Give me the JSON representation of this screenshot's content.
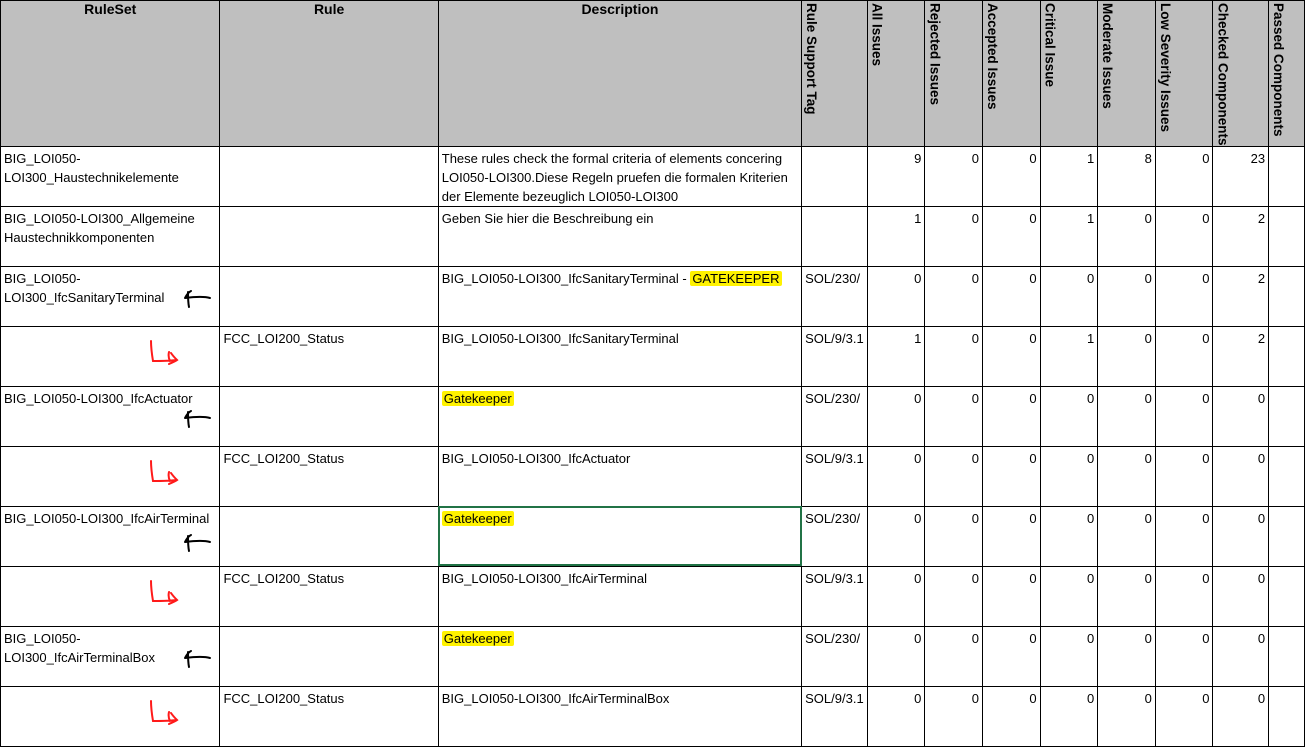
{
  "headers": {
    "ruleset": "RuleSet",
    "rule": "Rule",
    "description": "Description",
    "rule_support_tag": "Rule Support Tag",
    "all_issues": "All Issues",
    "rejected_issues": "Rejected Issues",
    "accepted_issues": "Accepted Issues",
    "critical_issue": "Critical Issue",
    "moderate_issues": "Moderate Issues",
    "low_severity_issues": "Low Severity Issues",
    "checked_components": "Checked Components",
    "passed_components": "Passed Components"
  },
  "rows": [
    {
      "ruleset": "BIG_LOI050-LOI300_Haustechnikelemente",
      "rule": "",
      "desc_main": "These rules check the formal criteria of elements concering LOI050-LOI300.Diese Regeln pruefen die formalen Kriterien der Elemente bezeuglich LOI050-LOI300",
      "desc_hl": "",
      "tag": "",
      "all": "9",
      "rejected": "0",
      "accepted": "0",
      "critical": "1",
      "moderate": "8",
      "low": "0",
      "checked": "23",
      "annotation": ""
    },
    {
      "ruleset": "BIG_LOI050-LOI300_Allgemeine Haustechnikkomponenten",
      "rule": "",
      "desc_main": "Geben Sie hier die Beschreibung ein",
      "desc_hl": "",
      "tag": "",
      "all": "1",
      "rejected": "0",
      "accepted": "0",
      "critical": "1",
      "moderate": "0",
      "low": "0",
      "checked": "2",
      "annotation": ""
    },
    {
      "ruleset": "BIG_LOI050-LOI300_IfcSanitaryTerminal",
      "rule": "",
      "desc_main": "BIG_LOI050-LOI300_IfcSanitaryTerminal - ",
      "desc_hl": "GATEKEEPER",
      "tag": "SOL/230/",
      "all": "0",
      "rejected": "0",
      "accepted": "0",
      "critical": "0",
      "moderate": "0",
      "low": "0",
      "checked": "2",
      "annotation": "black-arrow"
    },
    {
      "ruleset": "",
      "rule": "FCC_LOI200_Status",
      "desc_main": "BIG_LOI050-LOI300_IfcSanitaryTerminal",
      "desc_hl": "",
      "tag": "SOL/9/3.1",
      "all": "1",
      "rejected": "0",
      "accepted": "0",
      "critical": "1",
      "moderate": "0",
      "low": "0",
      "checked": "2",
      "annotation": "red-arrow"
    },
    {
      "ruleset": "BIG_LOI050-LOI300_IfcActuator",
      "rule": "",
      "desc_main": "",
      "desc_hl": "Gatekeeper",
      "tag": "SOL/230/",
      "all": "0",
      "rejected": "0",
      "accepted": "0",
      "critical": "0",
      "moderate": "0",
      "low": "0",
      "checked": "0",
      "annotation": "black-arrow"
    },
    {
      "ruleset": "",
      "rule": "FCC_LOI200_Status",
      "desc_main": "BIG_LOI050-LOI300_IfcActuator",
      "desc_hl": "",
      "tag": "SOL/9/3.1",
      "all": "0",
      "rejected": "0",
      "accepted": "0",
      "critical": "0",
      "moderate": "0",
      "low": "0",
      "checked": "0",
      "annotation": "red-arrow"
    },
    {
      "ruleset": "BIG_LOI050-LOI300_IfcAirTerminal",
      "rule": "",
      "desc_main": "",
      "desc_hl": "Gatekeeper",
      "tag": "SOL/230/",
      "all": "0",
      "rejected": "0",
      "accepted": "0",
      "critical": "0",
      "moderate": "0",
      "low": "0",
      "checked": "0",
      "annotation": "black-arrow",
      "selected": true
    },
    {
      "ruleset": "",
      "rule": "FCC_LOI200_Status",
      "desc_main": "BIG_LOI050-LOI300_IfcAirTerminal",
      "desc_hl": "",
      "tag": "SOL/9/3.1",
      "all": "0",
      "rejected": "0",
      "accepted": "0",
      "critical": "0",
      "moderate": "0",
      "low": "0",
      "checked": "0",
      "annotation": "red-arrow"
    },
    {
      "ruleset": "BIG_LOI050-LOI300_IfcAirTerminalBox",
      "rule": "",
      "desc_main": "",
      "desc_hl": "Gatekeeper",
      "tag": "SOL/230/",
      "all": "0",
      "rejected": "0",
      "accepted": "0",
      "critical": "0",
      "moderate": "0",
      "low": "0",
      "checked": "0",
      "annotation": "black-arrow"
    },
    {
      "ruleset": "",
      "rule": "FCC_LOI200_Status",
      "desc_main": "BIG_LOI050-LOI300_IfcAirTerminalBox",
      "desc_hl": "",
      "tag": "SOL/9/3.1",
      "all": "0",
      "rejected": "0",
      "accepted": "0",
      "critical": "0",
      "moderate": "0",
      "low": "0",
      "checked": "0",
      "annotation": "red-arrow"
    }
  ],
  "colors": {
    "header_bg": "#bfbfbf",
    "highlight": "#fff200",
    "selection": "#217346",
    "annotation_red": "#ff1a1a",
    "annotation_black": "#000000"
  },
  "icons": {
    "black-arrow": "hand-drawn-arrow-left-icon",
    "red-arrow": "hand-drawn-arrow-right-icon"
  }
}
